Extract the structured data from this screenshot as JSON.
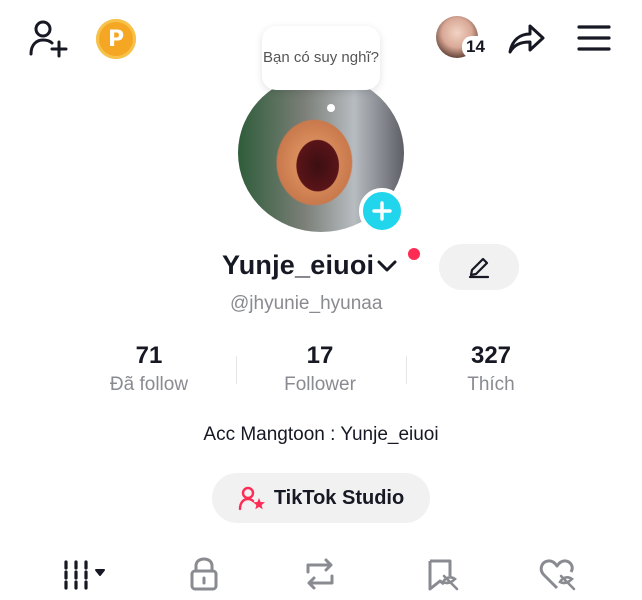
{
  "header": {
    "add_friend_icon": "person-plus-icon",
    "coin_letter": "P",
    "visitor_count": "14",
    "share_icon": "share-arrow-icon",
    "menu_icon": "hamburger-icon"
  },
  "profile": {
    "thought_bubble": "Bạn có suy nghĩ?",
    "username": "Yunje_eiuoi",
    "handle": "@jhyunie_hyunaa",
    "bio": "Acc Mangtoon : Yunje_eiuoi"
  },
  "stats": [
    {
      "value": "71",
      "label": "Đã follow"
    },
    {
      "value": "17",
      "label": "Follower"
    },
    {
      "value": "327",
      "label": "Thích"
    }
  ],
  "studio": {
    "label": "TikTok Studio"
  },
  "tabs": [
    "videos-grid-icon",
    "lock-icon",
    "repost-icon",
    "favorites-icon",
    "liked-icon"
  ],
  "colors": {
    "accent": "#fe2c55",
    "story_plus": "#20d5ec",
    "coin": "#f5a623"
  }
}
